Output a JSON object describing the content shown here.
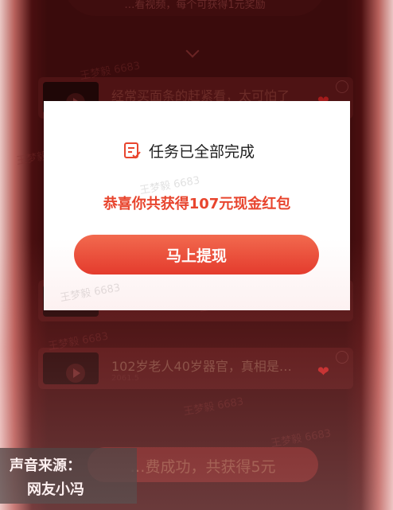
{
  "background": {
    "banner_text": "…看视频，每个可获得1元奖励",
    "watermarks": [
      "王梦毅 6683"
    ],
    "cards": [
      {
        "title": "经常买面条的赶紧看，太可怕了",
        "subtitle": ""
      },
      {
        "title": "",
        "subtitle": ""
      },
      {
        "title": "102岁老人40岁器官，真相是…",
        "subtitle": "2061.5"
      }
    ],
    "bottom_bar_text": "…费成功，共获得5元"
  },
  "modal": {
    "icon": "task-list-icon",
    "title": "任务已全部完成",
    "message": "恭喜你共获得107元现金红包",
    "button_label": "马上提现"
  },
  "caption": {
    "line1": "声音来源：",
    "line2": "网友小冯"
  },
  "colors": {
    "accent": "#e8452e",
    "button_start": "#f26a4f",
    "button_end": "#e4392a",
    "overlay_bg": "#3a0b0c"
  }
}
